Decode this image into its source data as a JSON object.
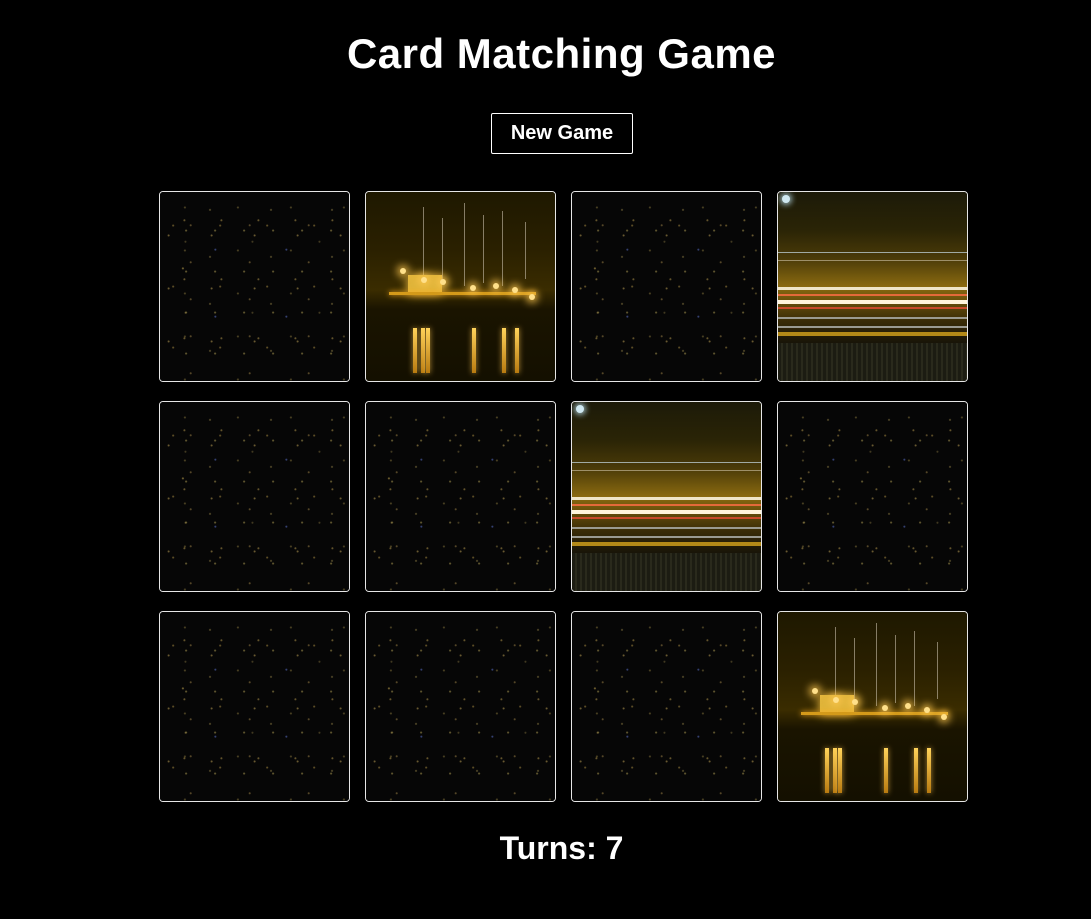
{
  "title": "Card Matching Game",
  "new_game_label": "New Game",
  "turns_label": "Turns:",
  "turns_value": "7",
  "colors": {
    "background": "#000000",
    "text": "#ffffff",
    "card_border": "#e6e6e6"
  },
  "cards": [
    {
      "state": "face-down",
      "image": "night-cityscape-back"
    },
    {
      "state": "face-up",
      "image": "harbor-night-lights"
    },
    {
      "state": "face-down",
      "image": "night-cityscape-back"
    },
    {
      "state": "face-up",
      "image": "highway-light-trails"
    },
    {
      "state": "face-down",
      "image": "night-cityscape-back"
    },
    {
      "state": "face-down",
      "image": "night-cityscape-back"
    },
    {
      "state": "face-up",
      "image": "highway-light-trails"
    },
    {
      "state": "face-down",
      "image": "night-cityscape-back"
    },
    {
      "state": "face-down",
      "image": "night-cityscape-back"
    },
    {
      "state": "face-down",
      "image": "night-cityscape-back"
    },
    {
      "state": "face-down",
      "image": "night-cityscape-back"
    },
    {
      "state": "face-up",
      "image": "harbor-night-lights"
    }
  ]
}
